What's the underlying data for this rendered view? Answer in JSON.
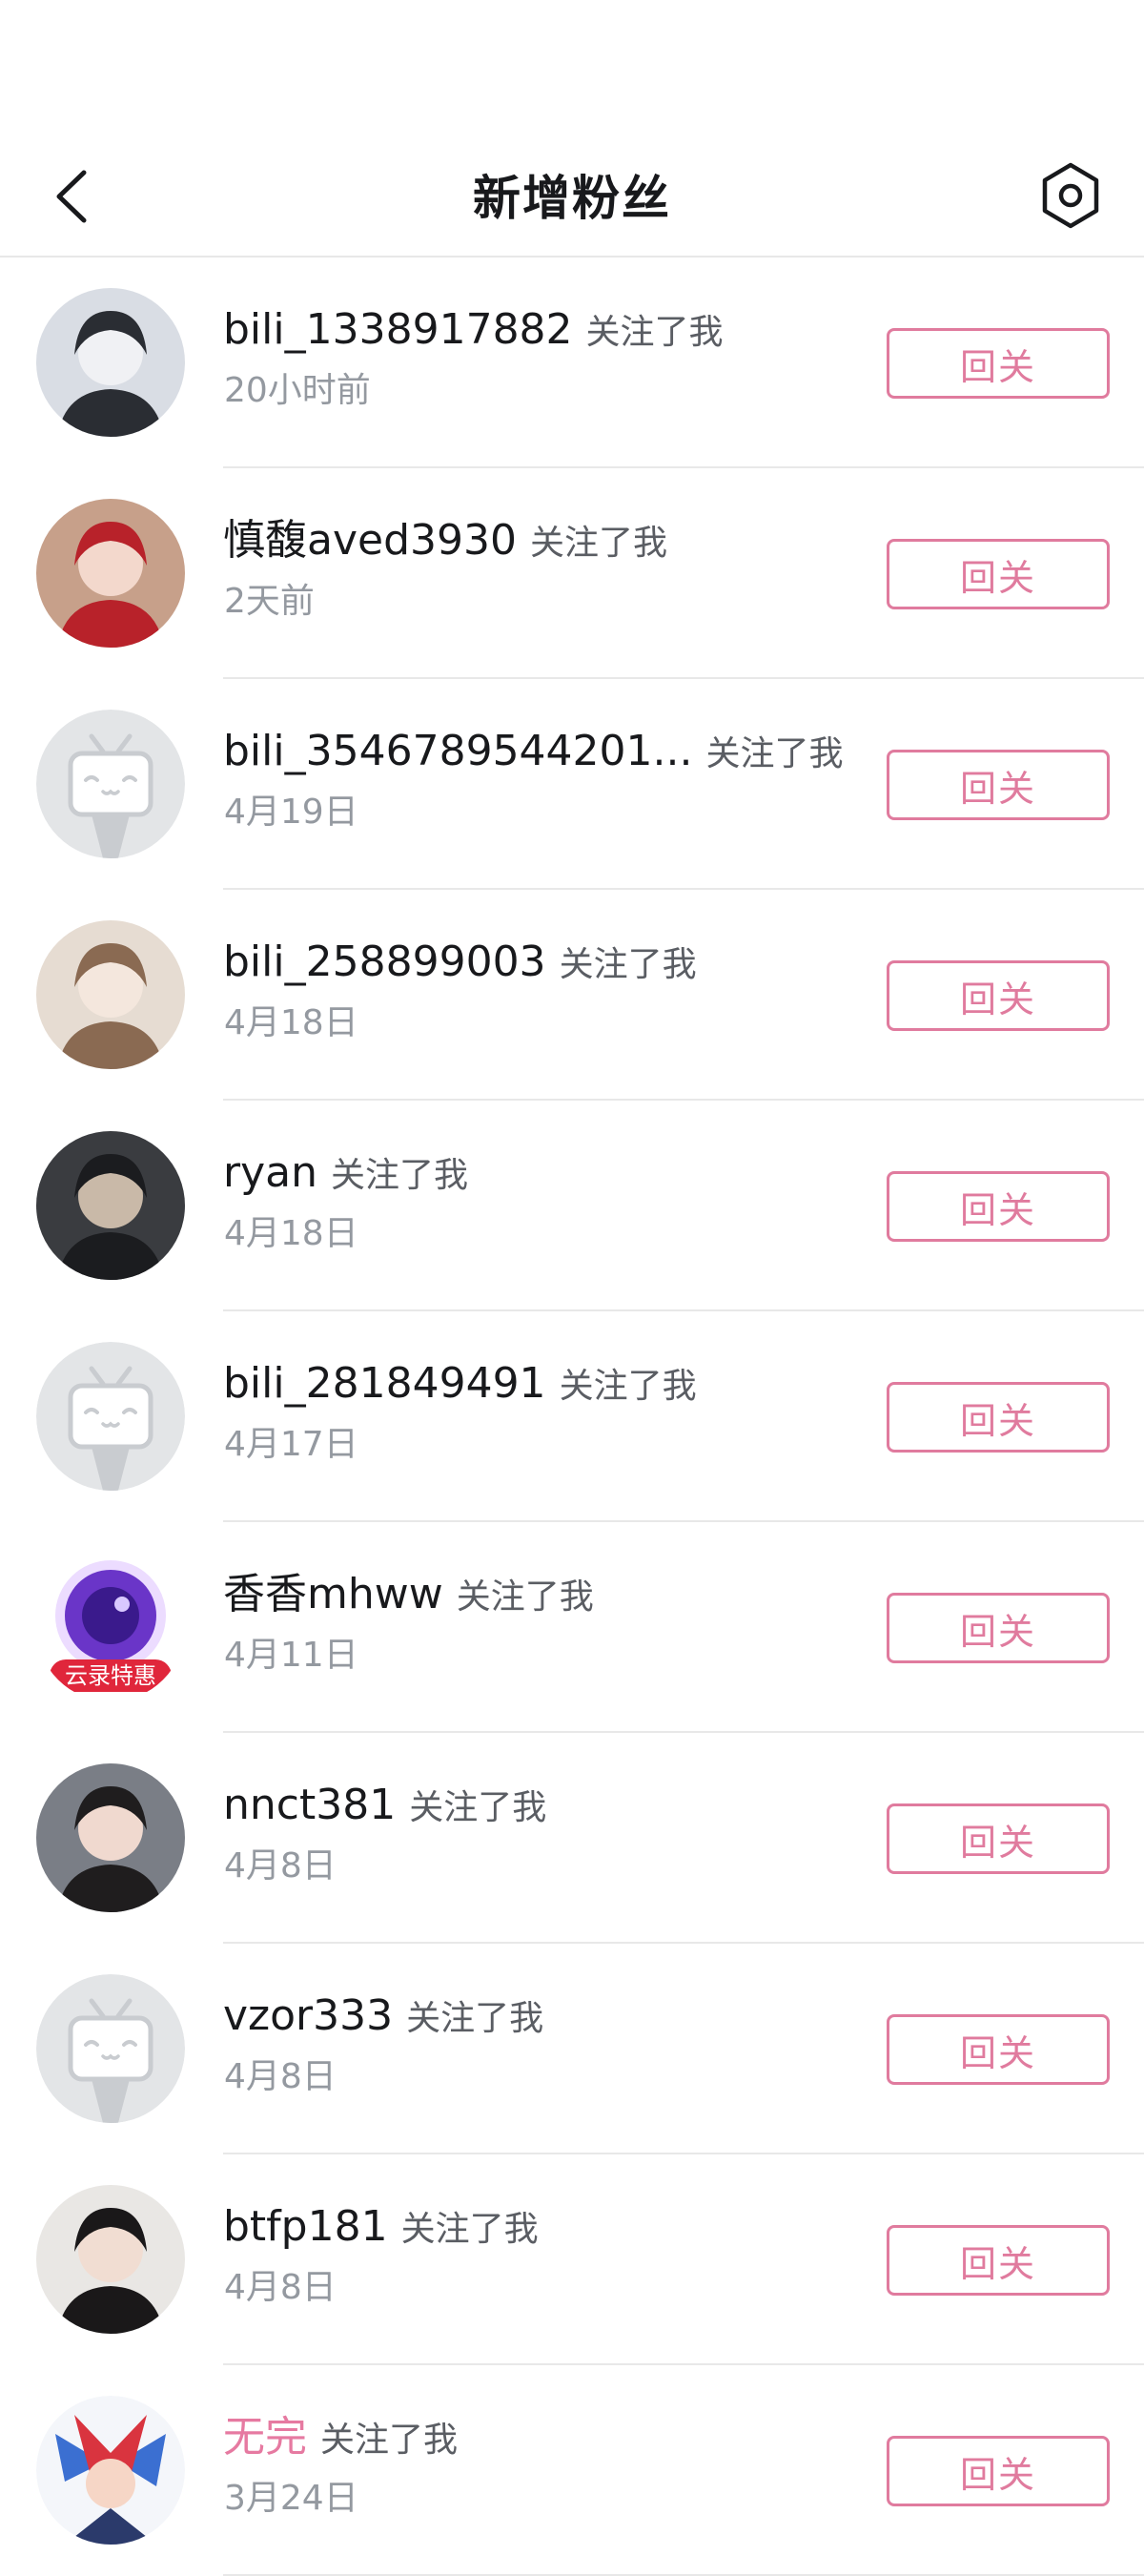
{
  "header": {
    "title": "新增粉丝"
  },
  "follow_button_label": "回关",
  "followers": [
    {
      "name": "bili_1338917882",
      "action": "关注了我",
      "time": "20小时前",
      "avatar": "photo"
    },
    {
      "name": "慎馥aved3930",
      "action": "关注了我",
      "time": "2天前",
      "avatar": "photo"
    },
    {
      "name": "bili_3546789544201...",
      "action": "关注了我",
      "time": "4月19日",
      "avatar": "default-tv"
    },
    {
      "name": "bili_258899003",
      "action": "关注了我",
      "time": "4月18日",
      "avatar": "photo"
    },
    {
      "name": "ryan",
      "action": "关注了我",
      "time": "4月18日",
      "avatar": "photo"
    },
    {
      "name": "bili_281849491",
      "action": "关注了我",
      "time": "4月17日",
      "avatar": "default-tv"
    },
    {
      "name": "香香mhww",
      "action": "关注了我",
      "time": "4月11日",
      "avatar": "app-logo",
      "avatar_badge": "云录特惠"
    },
    {
      "name": "nnct381",
      "action": "关注了我",
      "time": "4月8日",
      "avatar": "photo"
    },
    {
      "name": "vzor333",
      "action": "关注了我",
      "time": "4月8日",
      "avatar": "default-tv"
    },
    {
      "name": "btfp181",
      "action": "关注了我",
      "time": "4月8日",
      "avatar": "photo"
    },
    {
      "name": "无完",
      "action": "关注了我",
      "time": "3月24日",
      "avatar": "anime",
      "name_color": "#e67aa1"
    }
  ],
  "colors": {
    "accent": "#e07b9e",
    "divider": "#e8e8e8",
    "secondary_text": "#9499a0"
  },
  "icons": {
    "back": "chevron-left-icon",
    "settings": "settings-icon"
  }
}
